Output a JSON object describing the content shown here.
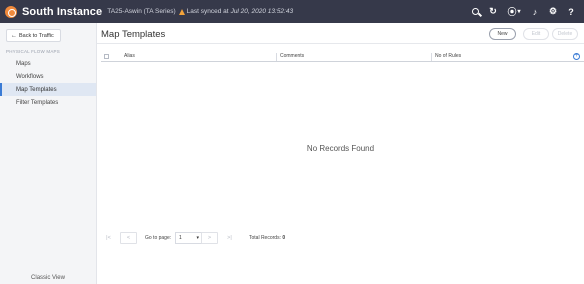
{
  "header": {
    "app_name": "South Instance",
    "instance_name": "TA25-Aswin (TA Series)",
    "sync_label": "Last synced at",
    "sync_time": "Jul 20, 2020 13:52:43",
    "icons": [
      "search-icon",
      "refresh-icon",
      "help-icon",
      "bell-icon",
      "gear-icon",
      "question-icon"
    ]
  },
  "sidebar": {
    "back_label": "Back to Traffic",
    "section_title": "PHYSICAL FLOW MAPS",
    "items": [
      {
        "label": "Maps",
        "active": false
      },
      {
        "label": "Workflows",
        "active": false
      },
      {
        "label": "Map Templates",
        "active": true
      },
      {
        "label": "Filter Templates",
        "active": false
      }
    ],
    "classic_view": "Classic View"
  },
  "main": {
    "title": "Map Templates",
    "buttons": {
      "new": "New",
      "edit": "Edit",
      "delete": "Delete"
    },
    "columns": [
      "Alias",
      "Comments",
      "No of Rules"
    ],
    "empty_message": "No Records Found",
    "pagination": {
      "goto_label": "Go to page:",
      "current_page": "1",
      "total_label": "Total Records:",
      "total_records": "0"
    }
  },
  "colors": {
    "topbar": "#36394a",
    "accent": "#3a7bd5",
    "logo": "#f08a3c",
    "warning": "#f2a33a"
  }
}
